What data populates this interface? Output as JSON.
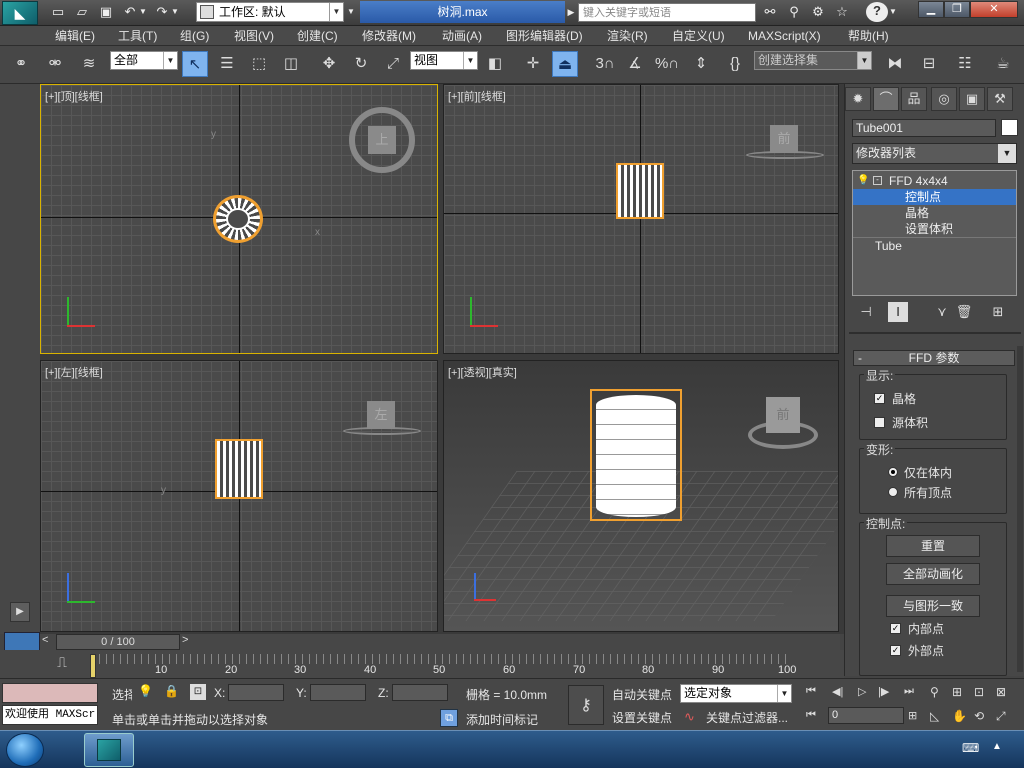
{
  "titlebar": {
    "workspace_label": "工作区: 默认",
    "file_title": "树洞.max",
    "search_placeholder": "键入关键字或短语",
    "help_icon": "?"
  },
  "menu": [
    "编辑(E)",
    "工具(T)",
    "组(G)",
    "视图(V)",
    "创建(C)",
    "修改器(M)",
    "动画(A)",
    "图形编辑器(D)",
    "渲染(R)",
    "自定义(U)",
    "MAXScript(X)",
    "帮助(H)"
  ],
  "toolbar": {
    "filter": "全部",
    "ref_coord": "视图",
    "selection_set": "创建选择集",
    "snap3": "3",
    "snap_pct": "%"
  },
  "viewports": [
    {
      "label": "[+][顶][线框]",
      "cube": "上"
    },
    {
      "label": "[+][前][线框]",
      "cube": "前"
    },
    {
      "label": "[+][左][线框]",
      "cube": "左"
    },
    {
      "label": "[+][透视][真实]",
      "cube": "前"
    }
  ],
  "axis": {
    "x": "x",
    "y": "y",
    "z": "z"
  },
  "command_panel": {
    "object_name": "Tube001",
    "modifier_list": "修改器列表",
    "stack": [
      "FFD 4x4x4",
      "控制点",
      "晶格",
      "设置体积",
      "Tube"
    ],
    "ffd_title": "FFD 参数",
    "display_label": "显示:",
    "lattice_label": "晶格",
    "source_volume_label": "源体积",
    "deform_label": "变形:",
    "only_in_volume": "仅在体内",
    "all_vertices": "所有顶点",
    "control_points_label": "控制点:",
    "reset_btn": "重置",
    "animate_all_btn": "全部动画化",
    "conform_btn": "与图形一致",
    "inside_points": "内部点",
    "outside_points": "外部点"
  },
  "timeline": {
    "slider": "0 / 100",
    "ticks": [
      "10",
      "20",
      "30",
      "40",
      "50",
      "60",
      "70",
      "80",
      "90",
      "100"
    ]
  },
  "status": {
    "maxscript_listener": "欢迎使用 MAXScr",
    "select_label": "选择",
    "prompt": "单击或单击并拖动以选择对象",
    "x_label": "X:",
    "y_label": "Y:",
    "z_label": "Z:",
    "grid": "栅格 = 10.0mm",
    "add_time_tag": "添加时间标记",
    "auto_key": "自动关键点",
    "set_key": "设置关键点",
    "key_mode": "选定对象",
    "key_filters": "关键点过滤器...",
    "frame": "0"
  },
  "colors": {
    "selection_orange": "#f0a030",
    "active_viewport": "#d9b300",
    "stack_highlight": "#3573c6"
  }
}
